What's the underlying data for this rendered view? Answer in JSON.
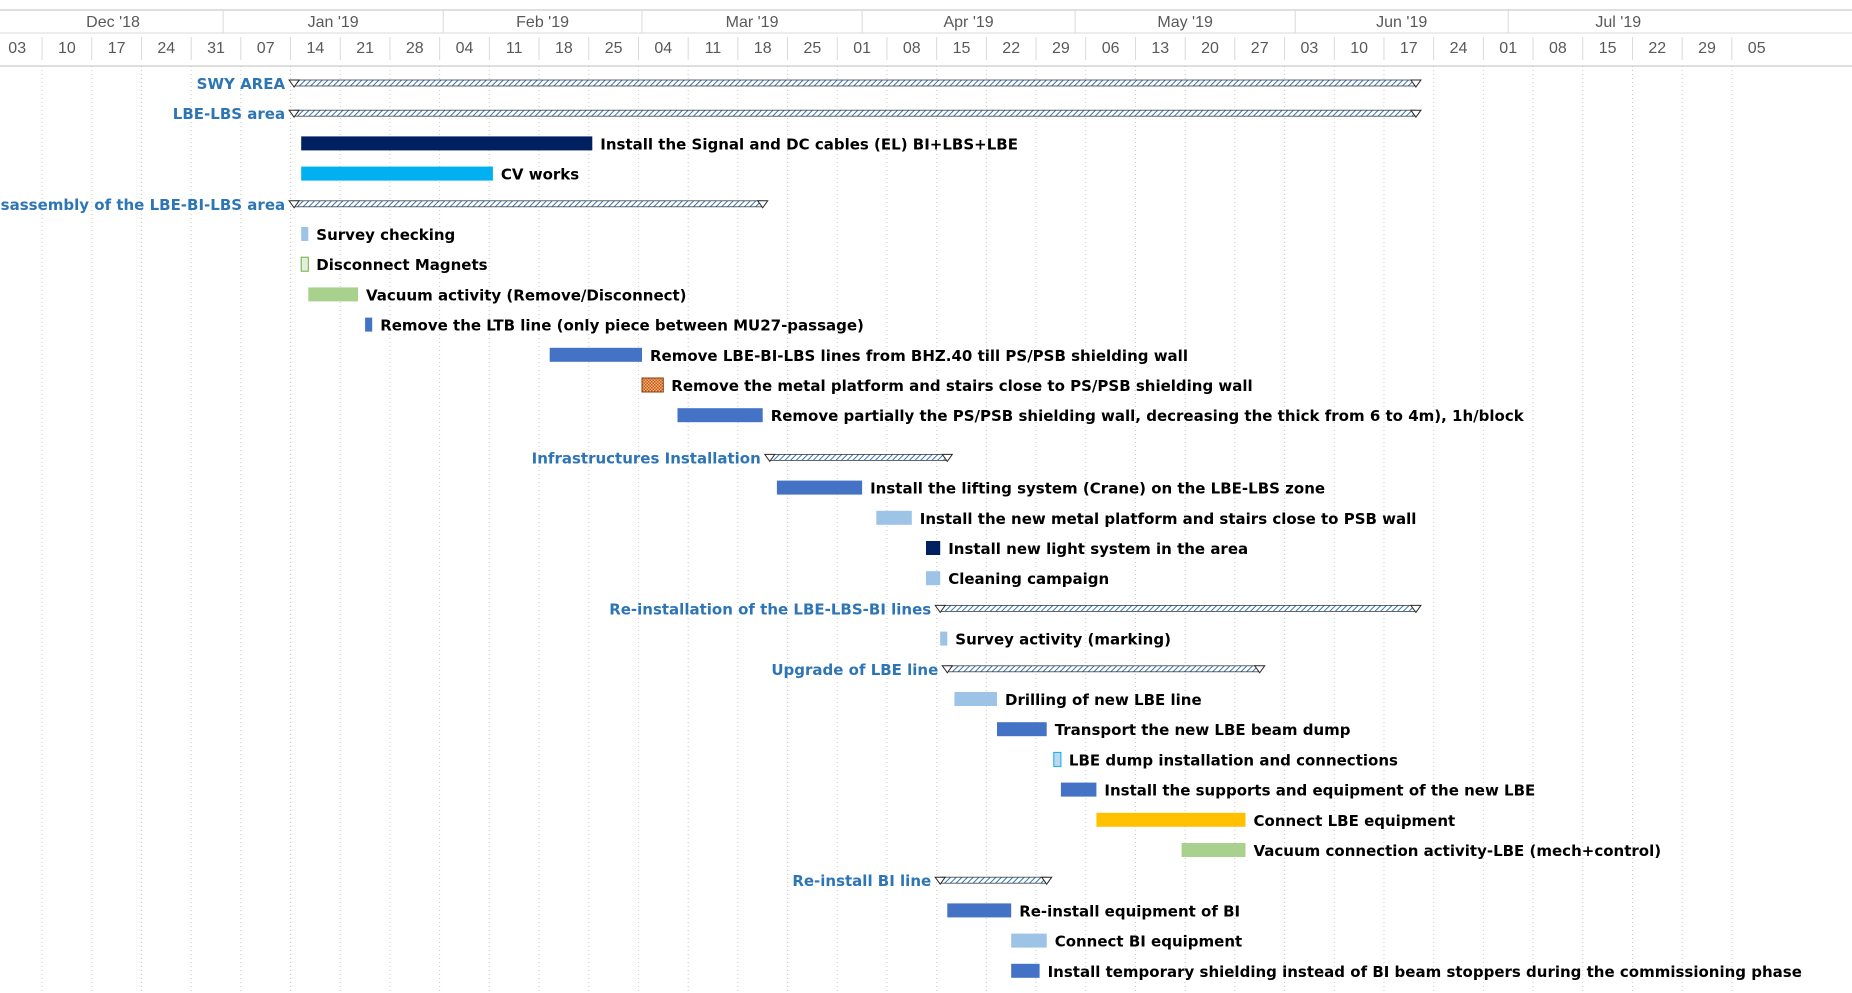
{
  "chart_data": {
    "type": "gantt",
    "timescale": {
      "months": [
        "Dec '18",
        "Jan '19",
        "Feb '19",
        "Mar '19",
        "Apr '19",
        "May '19",
        "Jun '19",
        "Jul '19"
      ],
      "week_labels": [
        "03",
        "10",
        "17",
        "24",
        "31",
        "07",
        "14",
        "21",
        "28",
        "04",
        "11",
        "18",
        "25",
        "04",
        "11",
        "18",
        "25",
        "01",
        "08",
        "15",
        "22",
        "29",
        "06",
        "13",
        "20",
        "27",
        "03",
        "10",
        "17",
        "24",
        "01",
        "08",
        "15",
        "22",
        "29",
        "05"
      ],
      "grid": "dotted vertical week lines"
    },
    "colors": {
      "summary_label": "#2E75B6",
      "dark_navy": "#002060",
      "cyan": "#00B0F0",
      "light_blue": "#9DC3E6",
      "green": "#A9D18E",
      "medium_blue": "#4472C4",
      "yellow": "#FFC000",
      "brown_pattern": "#C55A11",
      "summary_hatch": "#2E75B6"
    },
    "tasks": [
      {
        "name": "SWY AREA",
        "kind": "summary",
        "start": "2019-01-11",
        "end": "2019-06-18",
        "label_side": "left"
      },
      {
        "name": "LBE-LBS area",
        "kind": "summary",
        "start": "2019-01-11",
        "end": "2019-06-18",
        "label_side": "left"
      },
      {
        "name": "Install the Signal and DC cables (EL) BI+LBS+LBE",
        "kind": "task",
        "start": "2019-01-12",
        "end": "2019-02-22",
        "color": "dark_navy"
      },
      {
        "name": "CV works",
        "kind": "task",
        "start": "2019-01-12",
        "end": "2019-02-08",
        "color": "cyan"
      },
      {
        "name": "Disassembly of the  LBE-BI-LBS area",
        "kind": "summary",
        "start": "2019-01-11",
        "end": "2019-03-18",
        "label_side": "left"
      },
      {
        "name": "Survey checking",
        "kind": "task",
        "start": "2019-01-12",
        "end": "2019-01-13",
        "color": "light_blue"
      },
      {
        "name": "Disconnect Magnets",
        "kind": "task",
        "start": "2019-01-12",
        "end": "2019-01-13",
        "color": "green_outline"
      },
      {
        "name": "Vacuum activity (Remove/Disconnect)",
        "kind": "task",
        "start": "2019-01-13",
        "end": "2019-01-20",
        "color": "green"
      },
      {
        "name": "Remove the  LTB line (only piece between MU27-passage)",
        "kind": "task",
        "start": "2019-01-21",
        "end": "2019-01-22",
        "color": "medium_blue"
      },
      {
        "name": "Remove  LBE-BI-LBS lines from BHZ.40 till PS/PSB shielding wall",
        "kind": "task",
        "start": "2019-02-16",
        "end": "2019-03-01",
        "color": "medium_blue"
      },
      {
        "name": "Remove the metal platform and stairs close to PS/PSB shielding wall",
        "kind": "task",
        "start": "2019-03-01",
        "end": "2019-03-04",
        "color": "brown_pattern"
      },
      {
        "name": "Remove partially the PS/PSB shielding wall, decreasing the thick from 6 to 4m), 1h/block",
        "kind": "task",
        "start": "2019-03-06",
        "end": "2019-03-18",
        "color": "medium_blue"
      },
      {
        "name": "Infrastructures Installation",
        "kind": "summary",
        "start": "2019-03-19",
        "end": "2019-04-13",
        "label_side": "left",
        "gap_before": true
      },
      {
        "name": "Install the lifting system (Crane) on the LBE-LBS zone",
        "kind": "task",
        "start": "2019-03-20",
        "end": "2019-04-01",
        "color": "medium_blue"
      },
      {
        "name": "Install the new metal platform and stairs close to PSB wall",
        "kind": "task",
        "start": "2019-04-03",
        "end": "2019-04-08",
        "color": "light_blue"
      },
      {
        "name": "Install new light system in the area",
        "kind": "task",
        "start": "2019-04-10",
        "end": "2019-04-12",
        "color": "dark_navy"
      },
      {
        "name": "Cleaning campaign",
        "kind": "task",
        "start": "2019-04-10",
        "end": "2019-04-12",
        "color": "light_blue"
      },
      {
        "name": "Re-installation of the LBE-LBS-BI lines",
        "kind": "summary",
        "start": "2019-04-12",
        "end": "2019-06-18",
        "label_side": "left"
      },
      {
        "name": "Survey activity (marking)",
        "kind": "task",
        "start": "2019-04-12",
        "end": "2019-04-13",
        "color": "light_blue"
      },
      {
        "name": "Upgrade of LBE line",
        "kind": "summary",
        "start": "2019-04-13",
        "end": "2019-05-27",
        "label_side": "left"
      },
      {
        "name": "Drilling of new LBE line",
        "kind": "task",
        "start": "2019-04-14",
        "end": "2019-04-20",
        "color": "light_blue"
      },
      {
        "name": "Transport the new LBE beam dump",
        "kind": "task",
        "start": "2019-04-20",
        "end": "2019-04-27",
        "color": "medium_blue"
      },
      {
        "name": "LBE dump installation and connections",
        "kind": "task",
        "start": "2019-04-28",
        "end": "2019-04-29",
        "color": "cyan_outline"
      },
      {
        "name": "Install the supports and equipment of  the new LBE",
        "kind": "task",
        "start": "2019-04-29",
        "end": "2019-05-04",
        "color": "medium_blue"
      },
      {
        "name": "Connect LBE equipment",
        "kind": "task",
        "start": "2019-05-04",
        "end": "2019-05-25",
        "color": "yellow"
      },
      {
        "name": "Vacuum connection activity-LBE (mech+control)",
        "kind": "task",
        "start": "2019-05-16",
        "end": "2019-05-25",
        "color": "green"
      },
      {
        "name": "Re-install BI line",
        "kind": "summary",
        "start": "2019-04-12",
        "end": "2019-04-27",
        "label_side": "left"
      },
      {
        "name": "Re-install equipment of BI",
        "kind": "task",
        "start": "2019-04-13",
        "end": "2019-04-22",
        "color": "medium_blue"
      },
      {
        "name": "Connect BI equipment",
        "kind": "task",
        "start": "2019-04-22",
        "end": "2019-04-27",
        "color": "light_blue"
      },
      {
        "name": "Install temporary shielding instead of BI beam stoppers during the commissioning phase",
        "kind": "task",
        "start": "2019-04-22",
        "end": "2019-04-26",
        "color": "medium_blue"
      }
    ]
  }
}
